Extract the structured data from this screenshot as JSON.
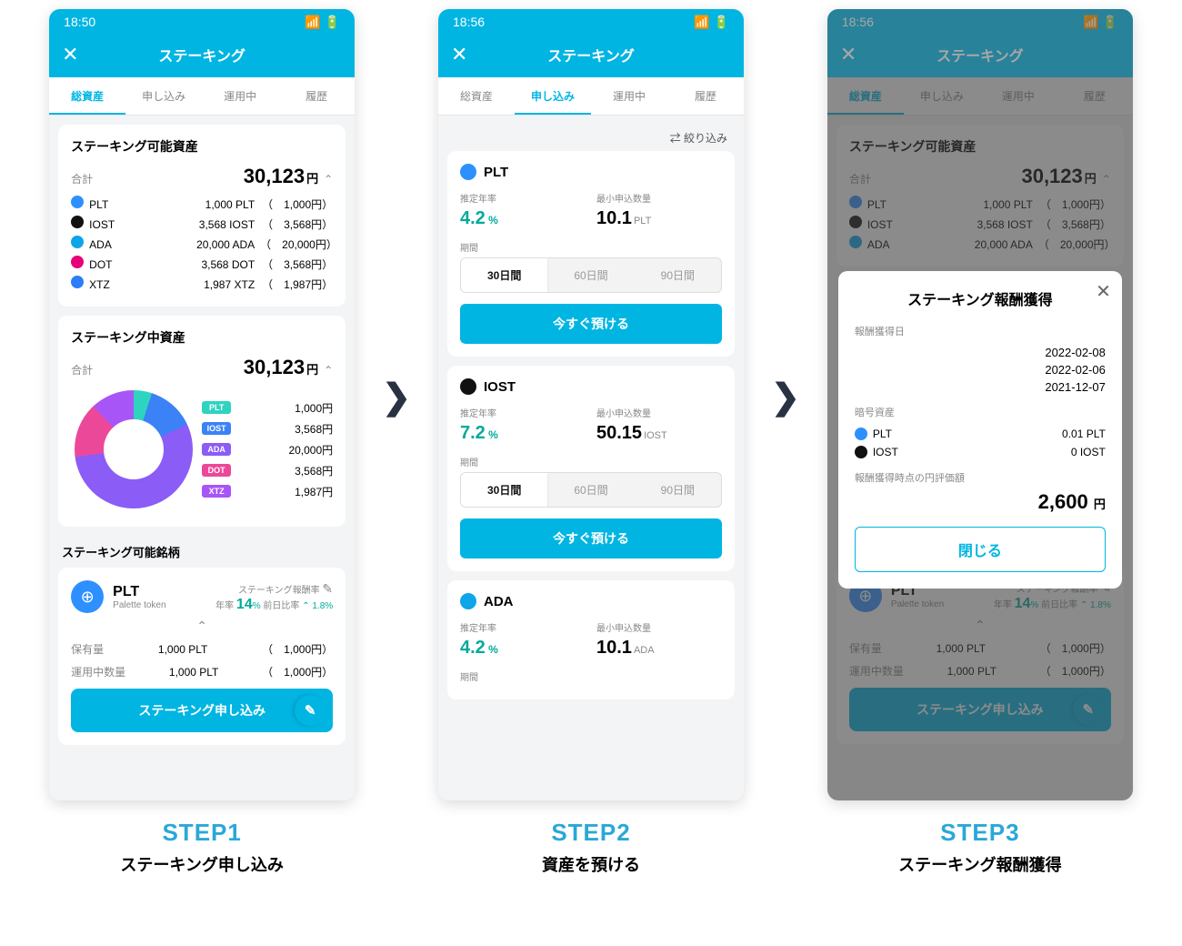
{
  "s1": {
    "time": "18:50",
    "title": "ステーキング",
    "tabs": [
      "総資産",
      "申し込み",
      "運用中",
      "履歴"
    ],
    "active": 0,
    "assets": {
      "title": "ステーキング可能資産",
      "totlab": "合計",
      "tot": "30,123",
      "yen": "円",
      "rows": [
        {
          "sym": "PLT",
          "amt": "1,000 PLT",
          "jpy": "1,000円",
          "c": "#2e90ff"
        },
        {
          "sym": "IOST",
          "amt": "3,568 IOST",
          "jpy": "3,568円",
          "c": "#111"
        },
        {
          "sym": "ADA",
          "amt": "20,000 ADA",
          "jpy": "20,000円",
          "c": "#0ea5e9"
        },
        {
          "sym": "DOT",
          "amt": "3,568 DOT",
          "jpy": "3,568円",
          "c": "#e6007a"
        },
        {
          "sym": "XTZ",
          "amt": "1,987 XTZ",
          "jpy": "1,987円",
          "c": "#2c7df7"
        }
      ]
    },
    "staking": {
      "title": "ステーキング中資産",
      "totlab": "合計",
      "tot": "30,123",
      "yen": "円",
      "rows": [
        {
          "sym": "PLT",
          "jpy": "1,000円",
          "c": "#2dd4bf"
        },
        {
          "sym": "IOST",
          "jpy": "3,568円",
          "c": "#3b82f6"
        },
        {
          "sym": "ADA",
          "jpy": "20,000円",
          "c": "#8b5cf6"
        },
        {
          "sym": "DOT",
          "jpy": "3,568円",
          "c": "#ec4899"
        },
        {
          "sym": "XTZ",
          "jpy": "1,987円",
          "c": "#a855f7"
        }
      ]
    },
    "avail": {
      "title": "ステーキング可能銘柄",
      "name": "PLT",
      "sub": "Palette token",
      "ratelab": "ステーキング報酬率",
      "ylab": "年率",
      "rate": "14",
      "ru": "%",
      "chlab": "前日比率",
      "chv": "1.8%",
      "holdlab": "保有量",
      "hold": "1,000 PLT",
      "holdj": "1,000円",
      "uselab": "運用中数量",
      "use": "1,000 PLT",
      "usej": "1,000円",
      "cta": "ステーキング申し込み"
    }
  },
  "s2": {
    "time": "18:56",
    "title": "ステーキング",
    "tabs": [
      "総資産",
      "申し込み",
      "運用中",
      "履歴"
    ],
    "active": 1,
    "filter": "絞り込み",
    "offers": [
      {
        "sym": "PLT",
        "c": "#2e90ff",
        "apylab": "推定年率",
        "apy": "4.2",
        "minlab": "最小申込数量",
        "min": "10.1",
        "unit": "PLT",
        "perlab": "期間",
        "periods": [
          "30日間",
          "60日間",
          "90日間"
        ],
        "deposit": "今すぐ預ける"
      },
      {
        "sym": "IOST",
        "c": "#111",
        "apylab": "推定年率",
        "apy": "7.2",
        "minlab": "最小申込数量",
        "min": "50.15",
        "unit": "IOST",
        "perlab": "期間",
        "periods": [
          "30日間",
          "60日間",
          "90日間"
        ],
        "deposit": "今すぐ預ける"
      },
      {
        "sym": "ADA",
        "c": "#0ea5e9",
        "apylab": "推定年率",
        "apy": "4.2",
        "minlab": "最小申込数量",
        "min": "10.1",
        "unit": "ADA",
        "perlab": "期間"
      }
    ]
  },
  "s3": {
    "time": "18:56",
    "title": "ステーキング",
    "modal": {
      "title": "ステーキング報酬獲得",
      "dlab": "報酬獲得日",
      "dates": [
        "2022-02-08",
        "2022-02-06",
        "2021-12-07"
      ],
      "alab": "暗号資産",
      "assets": [
        {
          "sym": "PLT",
          "v": "0.01 PLT",
          "c": "#2e90ff"
        },
        {
          "sym": "IOST",
          "v": "0 IOST",
          "c": "#111"
        }
      ],
      "vlab": "報酬獲得時点の円評価額",
      "tot": "2,600",
      "yen": "円",
      "close": "閉じる"
    }
  },
  "cap": [
    {
      "s": "STEP1",
      "t": "ステーキング申し込み"
    },
    {
      "s": "STEP2",
      "t": "資産を預ける"
    },
    {
      "s": "STEP3",
      "t": "ステーキング報酬獲得"
    }
  ]
}
